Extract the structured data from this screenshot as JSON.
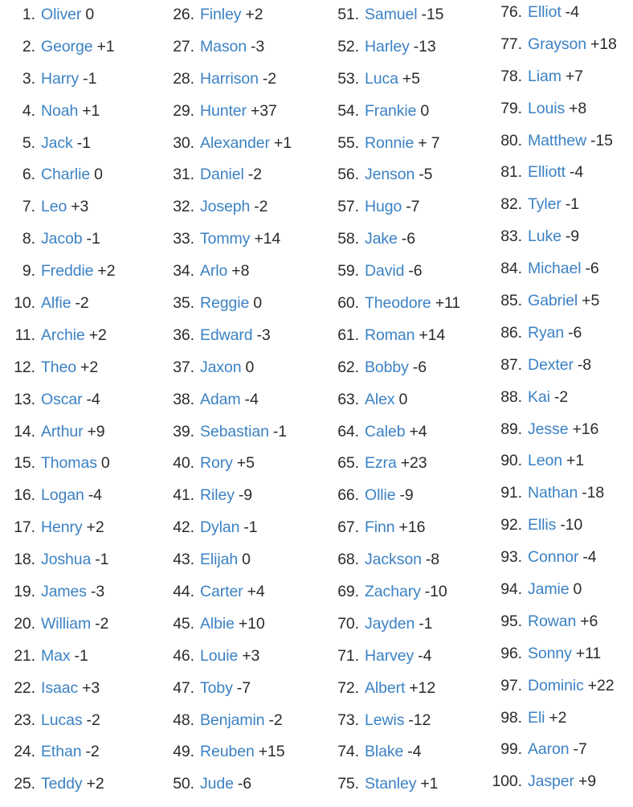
{
  "meta": {
    "colors": {
      "name": "#3b82c4",
      "rank": "#2b2b2b",
      "delta": "#2b2b2b",
      "background": "#ffffff"
    }
  },
  "columns": [
    {
      "id": "column-1",
      "entries": [
        {
          "rank": "1.",
          "name": "Oliver",
          "delta": "0"
        },
        {
          "rank": "2.",
          "name": "George",
          "delta": "+1"
        },
        {
          "rank": "3.",
          "name": "Harry",
          "delta": "-1"
        },
        {
          "rank": "4.",
          "name": "Noah",
          "delta": "+1"
        },
        {
          "rank": "5.",
          "name": "Jack",
          "delta": "-1"
        },
        {
          "rank": "6.",
          "name": "Charlie",
          "delta": "0"
        },
        {
          "rank": "7.",
          "name": "Leo",
          "delta": "+3"
        },
        {
          "rank": "8.",
          "name": "Jacob",
          "delta": "-1"
        },
        {
          "rank": "9.",
          "name": "Freddie",
          "delta": "+2"
        },
        {
          "rank": "10.",
          "name": "Alfie",
          "delta": "-2"
        },
        {
          "rank": "11.",
          "name": "Archie",
          "delta": "+2"
        },
        {
          "rank": "12.",
          "name": "Theo",
          "delta": "+2"
        },
        {
          "rank": "13.",
          "name": "Oscar",
          "delta": "-4"
        },
        {
          "rank": "14.",
          "name": "Arthur",
          "delta": "+9"
        },
        {
          "rank": "15.",
          "name": "Thomas",
          "delta": "0"
        },
        {
          "rank": "16.",
          "name": "Logan",
          "delta": "-4"
        },
        {
          "rank": "17.",
          "name": "Henry",
          "delta": "+2"
        },
        {
          "rank": "18.",
          "name": "Joshua",
          "delta": "-1"
        },
        {
          "rank": "19.",
          "name": "James",
          "delta": "-3"
        },
        {
          "rank": "20.",
          "name": "William",
          "delta": "-2"
        },
        {
          "rank": "21.",
          "name": "Max",
          "delta": "-1"
        },
        {
          "rank": "22.",
          "name": "Isaac",
          "delta": "+3"
        },
        {
          "rank": "23.",
          "name": "Lucas",
          "delta": "-2"
        },
        {
          "rank": "24.",
          "name": "Ethan",
          "delta": "-2"
        },
        {
          "rank": "25.",
          "name": "Teddy",
          "delta": "+2"
        }
      ]
    },
    {
      "id": "column-2",
      "entries": [
        {
          "rank": "26.",
          "name": "Finley",
          "delta": "+2"
        },
        {
          "rank": "27.",
          "name": "Mason",
          "delta": "-3"
        },
        {
          "rank": "28.",
          "name": "Harrison",
          "delta": "-2"
        },
        {
          "rank": "29.",
          "name": "Hunter",
          "delta": "+37"
        },
        {
          "rank": "30.",
          "name": "Alexander",
          "delta": "+1"
        },
        {
          "rank": "31.",
          "name": "Daniel",
          "delta": "-2"
        },
        {
          "rank": "32.",
          "name": "Joseph",
          "delta": "-2"
        },
        {
          "rank": "33.",
          "name": "Tommy",
          "delta": "+14"
        },
        {
          "rank": "34.",
          "name": "Arlo",
          "delta": "+8"
        },
        {
          "rank": "35.",
          "name": "Reggie",
          "delta": "0"
        },
        {
          "rank": "36.",
          "name": "Edward",
          "delta": "-3"
        },
        {
          "rank": "37.",
          "name": "Jaxon",
          "delta": "0"
        },
        {
          "rank": "38.",
          "name": "Adam",
          "delta": "-4"
        },
        {
          "rank": "39.",
          "name": "Sebastian",
          "delta": "-1"
        },
        {
          "rank": "40.",
          "name": "Rory",
          "delta": "+5"
        },
        {
          "rank": "41.",
          "name": "Riley",
          "delta": "-9"
        },
        {
          "rank": "42.",
          "name": "Dylan",
          "delta": "-1"
        },
        {
          "rank": "43.",
          "name": "Elijah",
          "delta": "0"
        },
        {
          "rank": "44.",
          "name": "Carter",
          "delta": "+4"
        },
        {
          "rank": "45.",
          "name": "Albie",
          "delta": "+10"
        },
        {
          "rank": "46.",
          "name": "Louie",
          "delta": "+3"
        },
        {
          "rank": "47.",
          "name": "Toby",
          "delta": "-7"
        },
        {
          "rank": "48.",
          "name": "Benjamin",
          "delta": "-2"
        },
        {
          "rank": "49.",
          "name": "Reuben",
          "delta": "+15"
        },
        {
          "rank": "50.",
          "name": "Jude",
          "delta": "-6"
        }
      ]
    },
    {
      "id": "column-3",
      "entries": [
        {
          "rank": "51.",
          "name": "Samuel",
          "delta": "-15"
        },
        {
          "rank": "52.",
          "name": "Harley",
          "delta": "-13"
        },
        {
          "rank": "53.",
          "name": "Luca",
          "delta": "+5"
        },
        {
          "rank": "54.",
          "name": "Frankie",
          "delta": "0"
        },
        {
          "rank": "55.",
          "name": "Ronnie",
          "delta": "+ 7"
        },
        {
          "rank": "56.",
          "name": "Jenson",
          "delta": "-5"
        },
        {
          "rank": "57.",
          "name": "Hugo",
          "delta": "-7"
        },
        {
          "rank": "58.",
          "name": "Jake",
          "delta": "-6"
        },
        {
          "rank": "59.",
          "name": "David",
          "delta": "-6"
        },
        {
          "rank": "60.",
          "name": "Theodore",
          "delta": "+11"
        },
        {
          "rank": "61.",
          "name": "Roman",
          "delta": "+14"
        },
        {
          "rank": "62.",
          "name": "Bobby",
          "delta": "-6"
        },
        {
          "rank": "63.",
          "name": "Alex",
          "delta": "0"
        },
        {
          "rank": "64.",
          "name": "Caleb",
          "delta": "+4"
        },
        {
          "rank": "65.",
          "name": "Ezra",
          "delta": "+23"
        },
        {
          "rank": "66.",
          "name": "Ollie",
          "delta": "-9"
        },
        {
          "rank": "67.",
          "name": "Finn",
          "delta": "+16"
        },
        {
          "rank": "68.",
          "name": "Jackson",
          "delta": "-8"
        },
        {
          "rank": "69.",
          "name": "Zachary",
          "delta": "-10"
        },
        {
          "rank": "70.",
          "name": "Jayden",
          "delta": "-1"
        },
        {
          "rank": "71.",
          "name": "Harvey",
          "delta": "-4"
        },
        {
          "rank": "72.",
          "name": "Albert",
          "delta": "+12"
        },
        {
          "rank": "73.",
          "name": "Lewis",
          "delta": "-12"
        },
        {
          "rank": "74.",
          "name": "Blake",
          "delta": "-4"
        },
        {
          "rank": "75.",
          "name": "Stanley",
          "delta": "+1"
        }
      ]
    },
    {
      "id": "column-4",
      "entries": [
        {
          "rank": "76.",
          "name": "Elliot",
          "delta": "-4"
        },
        {
          "rank": "77.",
          "name": "Grayson",
          "delta": "+18"
        },
        {
          "rank": "78.",
          "name": "Liam",
          "delta": "+7"
        },
        {
          "rank": "79.",
          "name": "Louis",
          "delta": "+8"
        },
        {
          "rank": "80.",
          "name": "Matthew",
          "delta": "-15"
        },
        {
          "rank": "81.",
          "name": "Elliott",
          "delta": "-4"
        },
        {
          "rank": "82.",
          "name": "Tyler",
          "delta": "-1"
        },
        {
          "rank": "83.",
          "name": "Luke",
          "delta": "-9"
        },
        {
          "rank": "84.",
          "name": "Michael",
          "delta": "-6"
        },
        {
          "rank": "85.",
          "name": "Gabriel",
          "delta": "+5"
        },
        {
          "rank": "86.",
          "name": "Ryan",
          "delta": "-6"
        },
        {
          "rank": "87.",
          "name": "Dexter",
          "delta": "-8"
        },
        {
          "rank": "88.",
          "name": "Kai",
          "delta": "-2"
        },
        {
          "rank": "89.",
          "name": "Jesse",
          "delta": "+16"
        },
        {
          "rank": "90.",
          "name": "Leon",
          "delta": "+1"
        },
        {
          "rank": "91.",
          "name": "Nathan",
          "delta": "-18"
        },
        {
          "rank": "92.",
          "name": "Ellis",
          "delta": "-10"
        },
        {
          "rank": "93.",
          "name": "Connor",
          "delta": "-4"
        },
        {
          "rank": "94.",
          "name": "Jamie",
          "delta": "0"
        },
        {
          "rank": "95.",
          "name": "Rowan",
          "delta": "+6"
        },
        {
          "rank": "96.",
          "name": "Sonny",
          "delta": "+11"
        },
        {
          "rank": "97.",
          "name": "Dominic",
          "delta": "+22"
        },
        {
          "rank": "98.",
          "name": "Eli",
          "delta": "+2"
        },
        {
          "rank": "99.",
          "name": "Aaron",
          "delta": "-7"
        },
        {
          "rank": "100.",
          "name": "Jasper",
          "delta": "+9"
        }
      ]
    }
  ]
}
